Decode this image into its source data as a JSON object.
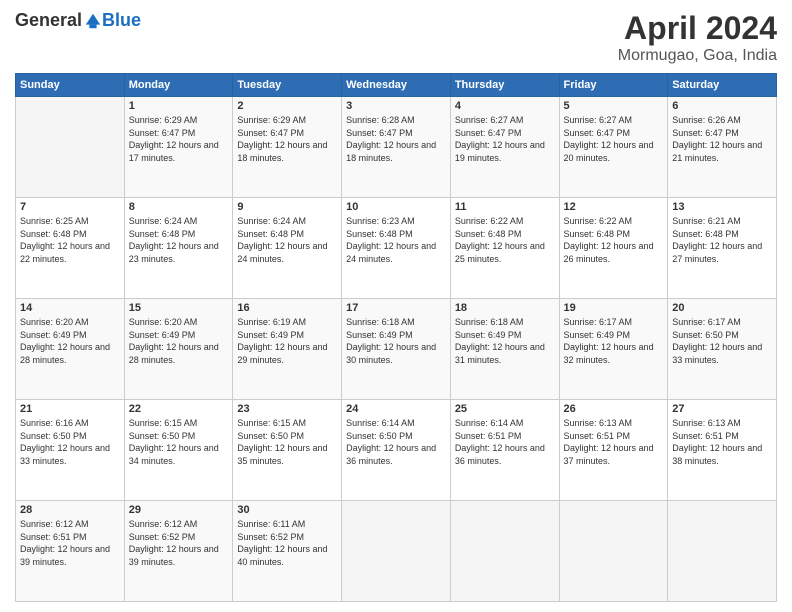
{
  "logo": {
    "general": "General",
    "blue": "Blue"
  },
  "title": "April 2024",
  "subtitle": "Mormugao, Goa, India",
  "days_of_week": [
    "Sunday",
    "Monday",
    "Tuesday",
    "Wednesday",
    "Thursday",
    "Friday",
    "Saturday"
  ],
  "weeks": [
    [
      {
        "num": "",
        "sunrise": "",
        "sunset": "",
        "daylight": ""
      },
      {
        "num": "1",
        "sunrise": "Sunrise: 6:29 AM",
        "sunset": "Sunset: 6:47 PM",
        "daylight": "Daylight: 12 hours and 17 minutes."
      },
      {
        "num": "2",
        "sunrise": "Sunrise: 6:29 AM",
        "sunset": "Sunset: 6:47 PM",
        "daylight": "Daylight: 12 hours and 18 minutes."
      },
      {
        "num": "3",
        "sunrise": "Sunrise: 6:28 AM",
        "sunset": "Sunset: 6:47 PM",
        "daylight": "Daylight: 12 hours and 18 minutes."
      },
      {
        "num": "4",
        "sunrise": "Sunrise: 6:27 AM",
        "sunset": "Sunset: 6:47 PM",
        "daylight": "Daylight: 12 hours and 19 minutes."
      },
      {
        "num": "5",
        "sunrise": "Sunrise: 6:27 AM",
        "sunset": "Sunset: 6:47 PM",
        "daylight": "Daylight: 12 hours and 20 minutes."
      },
      {
        "num": "6",
        "sunrise": "Sunrise: 6:26 AM",
        "sunset": "Sunset: 6:47 PM",
        "daylight": "Daylight: 12 hours and 21 minutes."
      }
    ],
    [
      {
        "num": "7",
        "sunrise": "Sunrise: 6:25 AM",
        "sunset": "Sunset: 6:48 PM",
        "daylight": "Daylight: 12 hours and 22 minutes."
      },
      {
        "num": "8",
        "sunrise": "Sunrise: 6:24 AM",
        "sunset": "Sunset: 6:48 PM",
        "daylight": "Daylight: 12 hours and 23 minutes."
      },
      {
        "num": "9",
        "sunrise": "Sunrise: 6:24 AM",
        "sunset": "Sunset: 6:48 PM",
        "daylight": "Daylight: 12 hours and 24 minutes."
      },
      {
        "num": "10",
        "sunrise": "Sunrise: 6:23 AM",
        "sunset": "Sunset: 6:48 PM",
        "daylight": "Daylight: 12 hours and 24 minutes."
      },
      {
        "num": "11",
        "sunrise": "Sunrise: 6:22 AM",
        "sunset": "Sunset: 6:48 PM",
        "daylight": "Daylight: 12 hours and 25 minutes."
      },
      {
        "num": "12",
        "sunrise": "Sunrise: 6:22 AM",
        "sunset": "Sunset: 6:48 PM",
        "daylight": "Daylight: 12 hours and 26 minutes."
      },
      {
        "num": "13",
        "sunrise": "Sunrise: 6:21 AM",
        "sunset": "Sunset: 6:48 PM",
        "daylight": "Daylight: 12 hours and 27 minutes."
      }
    ],
    [
      {
        "num": "14",
        "sunrise": "Sunrise: 6:20 AM",
        "sunset": "Sunset: 6:49 PM",
        "daylight": "Daylight: 12 hours and 28 minutes."
      },
      {
        "num": "15",
        "sunrise": "Sunrise: 6:20 AM",
        "sunset": "Sunset: 6:49 PM",
        "daylight": "Daylight: 12 hours and 28 minutes."
      },
      {
        "num": "16",
        "sunrise": "Sunrise: 6:19 AM",
        "sunset": "Sunset: 6:49 PM",
        "daylight": "Daylight: 12 hours and 29 minutes."
      },
      {
        "num": "17",
        "sunrise": "Sunrise: 6:18 AM",
        "sunset": "Sunset: 6:49 PM",
        "daylight": "Daylight: 12 hours and 30 minutes."
      },
      {
        "num": "18",
        "sunrise": "Sunrise: 6:18 AM",
        "sunset": "Sunset: 6:49 PM",
        "daylight": "Daylight: 12 hours and 31 minutes."
      },
      {
        "num": "19",
        "sunrise": "Sunrise: 6:17 AM",
        "sunset": "Sunset: 6:49 PM",
        "daylight": "Daylight: 12 hours and 32 minutes."
      },
      {
        "num": "20",
        "sunrise": "Sunrise: 6:17 AM",
        "sunset": "Sunset: 6:50 PM",
        "daylight": "Daylight: 12 hours and 33 minutes."
      }
    ],
    [
      {
        "num": "21",
        "sunrise": "Sunrise: 6:16 AM",
        "sunset": "Sunset: 6:50 PM",
        "daylight": "Daylight: 12 hours and 33 minutes."
      },
      {
        "num": "22",
        "sunrise": "Sunrise: 6:15 AM",
        "sunset": "Sunset: 6:50 PM",
        "daylight": "Daylight: 12 hours and 34 minutes."
      },
      {
        "num": "23",
        "sunrise": "Sunrise: 6:15 AM",
        "sunset": "Sunset: 6:50 PM",
        "daylight": "Daylight: 12 hours and 35 minutes."
      },
      {
        "num": "24",
        "sunrise": "Sunrise: 6:14 AM",
        "sunset": "Sunset: 6:50 PM",
        "daylight": "Daylight: 12 hours and 36 minutes."
      },
      {
        "num": "25",
        "sunrise": "Sunrise: 6:14 AM",
        "sunset": "Sunset: 6:51 PM",
        "daylight": "Daylight: 12 hours and 36 minutes."
      },
      {
        "num": "26",
        "sunrise": "Sunrise: 6:13 AM",
        "sunset": "Sunset: 6:51 PM",
        "daylight": "Daylight: 12 hours and 37 minutes."
      },
      {
        "num": "27",
        "sunrise": "Sunrise: 6:13 AM",
        "sunset": "Sunset: 6:51 PM",
        "daylight": "Daylight: 12 hours and 38 minutes."
      }
    ],
    [
      {
        "num": "28",
        "sunrise": "Sunrise: 6:12 AM",
        "sunset": "Sunset: 6:51 PM",
        "daylight": "Daylight: 12 hours and 39 minutes."
      },
      {
        "num": "29",
        "sunrise": "Sunrise: 6:12 AM",
        "sunset": "Sunset: 6:52 PM",
        "daylight": "Daylight: 12 hours and 39 minutes."
      },
      {
        "num": "30",
        "sunrise": "Sunrise: 6:11 AM",
        "sunset": "Sunset: 6:52 PM",
        "daylight": "Daylight: 12 hours and 40 minutes."
      },
      {
        "num": "",
        "sunrise": "",
        "sunset": "",
        "daylight": ""
      },
      {
        "num": "",
        "sunrise": "",
        "sunset": "",
        "daylight": ""
      },
      {
        "num": "",
        "sunrise": "",
        "sunset": "",
        "daylight": ""
      },
      {
        "num": "",
        "sunrise": "",
        "sunset": "",
        "daylight": ""
      }
    ]
  ]
}
